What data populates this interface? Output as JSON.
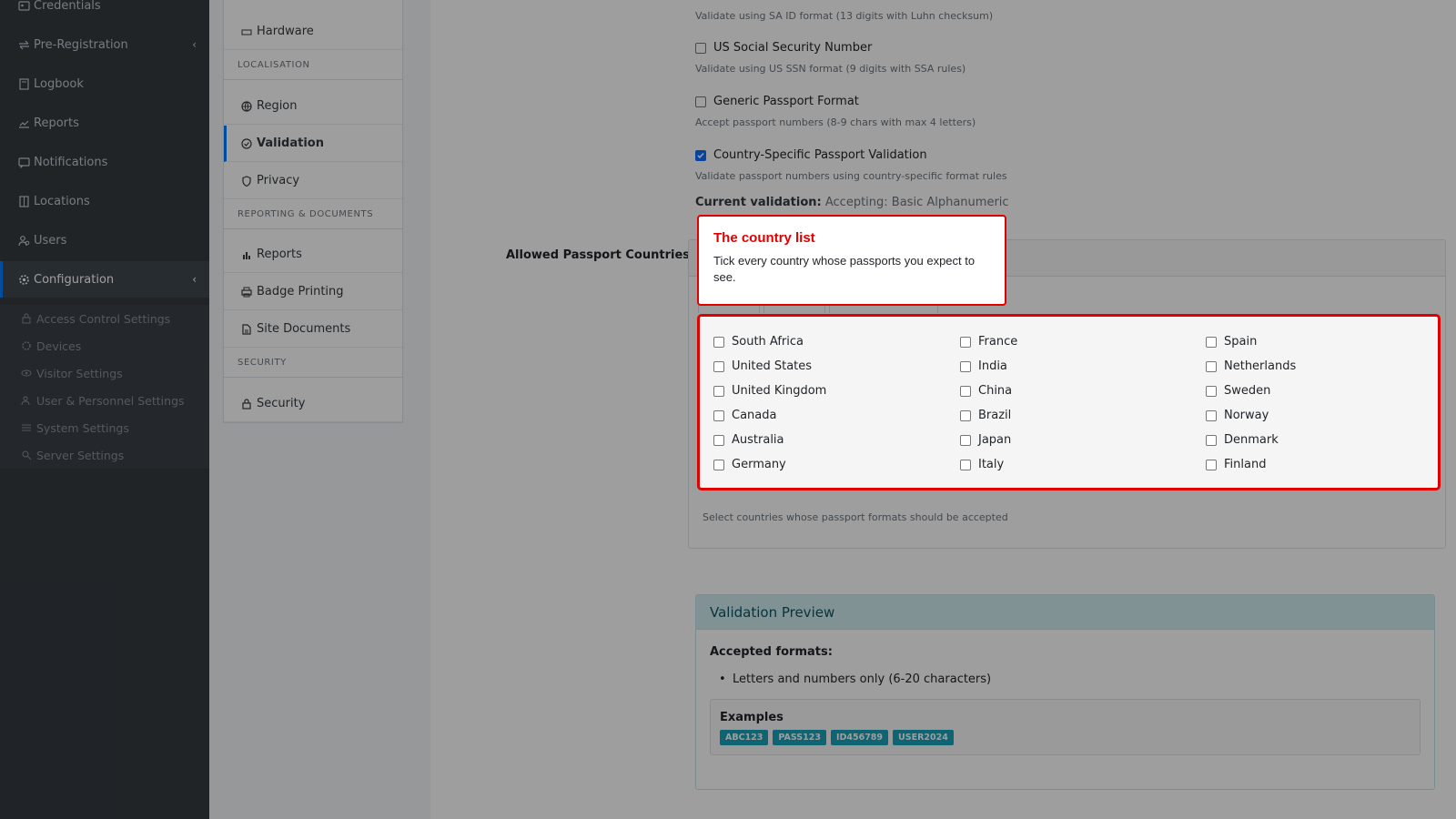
{
  "sidebar": {
    "items": [
      {
        "label": "Credentials",
        "icon": "id-card-icon"
      },
      {
        "label": "Pre-Registration",
        "icon": "arrows-icon",
        "chevron": "‹"
      },
      {
        "label": "Logbook",
        "icon": "book-icon"
      },
      {
        "label": "Reports",
        "icon": "chart-icon"
      },
      {
        "label": "Notifications",
        "icon": "bell-icon"
      },
      {
        "label": "Locations",
        "icon": "building-icon"
      },
      {
        "label": "Users",
        "icon": "users-icon"
      },
      {
        "label": "Configuration",
        "icon": "gear-icon",
        "chevron": "‹"
      }
    ],
    "sub_items": [
      {
        "label": "Access Control Settings",
        "icon": "lock-icon"
      },
      {
        "label": "Devices",
        "icon": "cog-icon"
      },
      {
        "label": "Visitor Settings",
        "icon": "eye-icon"
      },
      {
        "label": "User & Personnel Settings",
        "icon": "users-icon"
      },
      {
        "label": "System Settings",
        "icon": "sliders-icon"
      },
      {
        "label": "Server Settings",
        "icon": "server-icon"
      }
    ]
  },
  "settings_menu": {
    "hardware": "Hardware",
    "localisation_header": "LOCALISATION",
    "region": "Region",
    "validation": "Validation",
    "privacy": "Privacy",
    "reporting_header": "REPORTING & DOCUMENTS",
    "reports": "Reports",
    "badge_printing": "Badge Printing",
    "site_documents": "Site Documents",
    "security_header": "SECURITY",
    "security": "Security"
  },
  "validation": {
    "sa_id_help": "Validate using SA ID format (13 digits with Luhn checksum)",
    "us_ssn_label": "US Social Security Number",
    "us_ssn_help": "Validate using US SSN format (9 digits with SSA rules)",
    "generic_passport_label": "Generic Passport Format",
    "generic_passport_help": "Accept passport numbers (8-9 chars with max 4 letters)",
    "country_passport_label": "Country-Specific Passport Validation",
    "country_passport_help": "Validate passport numbers using country-specific format rules",
    "current_label": "Current validation:",
    "current_value": "Accepting: Basic Alphanumeric"
  },
  "allowed_countries": {
    "label": "Allowed Passport Countries",
    "countries": [
      "South Africa",
      "United States",
      "United Kingdom",
      "Canada",
      "Australia",
      "Germany",
      "France",
      "India",
      "China",
      "Brazil",
      "Japan",
      "Italy",
      "Spain",
      "Netherlands",
      "Sweden",
      "Norway",
      "Denmark",
      "Finland"
    ],
    "help": "Select countries whose passport formats should be accepted"
  },
  "preview": {
    "title": "Validation Preview",
    "accepted_label": "Accepted formats:",
    "accepted_item": "Letters and numbers only (6-20 characters)",
    "examples_label": "Examples",
    "examples": [
      "ABC123",
      "PASS123",
      "ID456789",
      "USER2024"
    ]
  },
  "tooltip": {
    "title": "The country list",
    "body": "Tick every country whose passports you expect to see."
  },
  "colors": {
    "accent": "#007bff",
    "highlight": "#e00000",
    "badge": "#17a2b8"
  }
}
